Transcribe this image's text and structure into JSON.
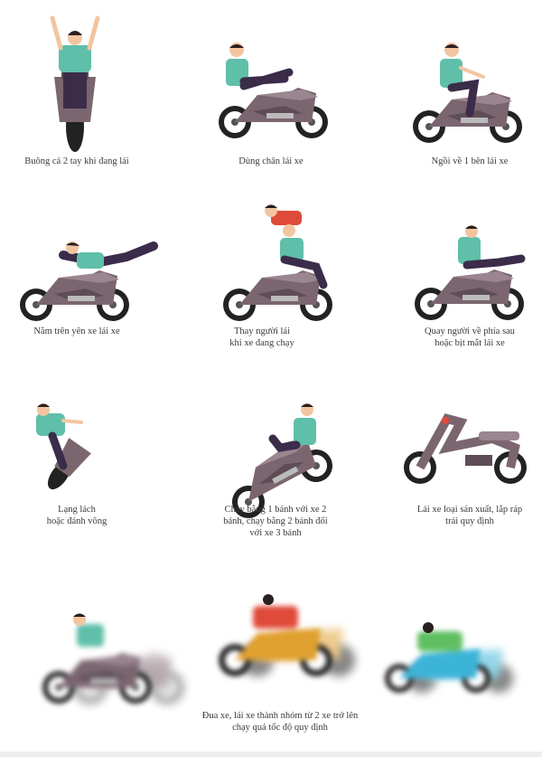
{
  "captions": {
    "c1": "Buông cả 2 tay khi đang lái",
    "c2": "Dùng chân lái xe",
    "c3": "Ngồi về 1 bên lái xe",
    "c4": "Nằm trên yên xe lái xe",
    "c5_line1": "Thay người lái",
    "c5_line2": "khi xe đang chạy",
    "c6_line1": "Quay người về phía sau",
    "c6_line2": "hoặc bịt mắt lái xe",
    "c7_line1": "Lạng lách",
    "c7_line2": "hoặc đánh võng",
    "c8_line1": "Chạy bằng 1 bánh với xe 2",
    "c8_line2": "bánh, chạy bằng 2 bánh đối",
    "c8_line3": "với xe 3 bánh",
    "c9_line1": "Lái xe loại sản xuất, lắp ráp",
    "c9_line2": "trái quy định",
    "c10_line1": "Đua xe, lái xe thành nhóm từ 2 xe trở lên",
    "c10_line2": "chạy quá tốc độ quy định"
  },
  "colors": {
    "bike_body": "#7b6670",
    "shirt": "#5fbfa9",
    "pants": "#3b2c4a",
    "skin": "#f2c5a0",
    "hair": "#2a2020",
    "tire": "#222222",
    "red_shirt": "#e04a3a",
    "orange_bike": "#e0a030",
    "blue_bike": "#3cb4d8"
  }
}
